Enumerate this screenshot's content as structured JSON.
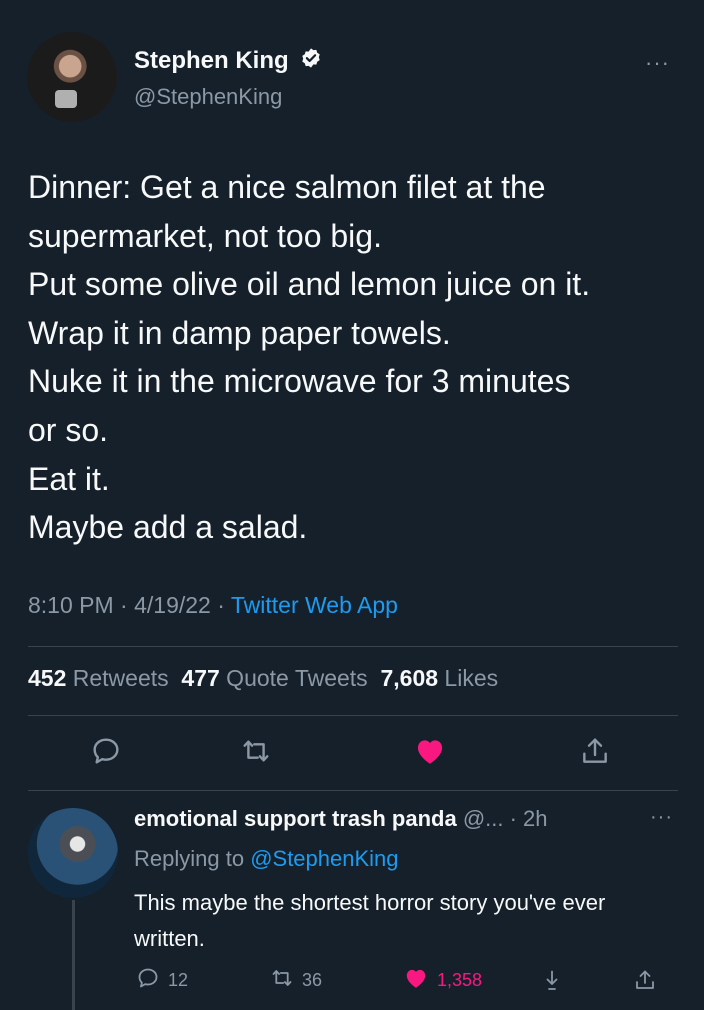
{
  "tweet": {
    "author_name": "Stephen King",
    "author_handle": "@StephenKing",
    "more_glyph": "···",
    "body_lines": [
      "Dinner: Get a nice salmon filet at the",
      "supermarket, not too big.",
      "Put some olive oil and lemon juice on it.",
      "Wrap it in damp paper towels.",
      "Nuke it in the microwave for 3 minutes",
      "or so.",
      "Eat it.",
      "Maybe add a salad."
    ],
    "time": "8:10 PM",
    "separator": " · ",
    "date": "4/19/22",
    "source": "Twitter Web App",
    "stats": {
      "retweets_count": "452",
      "retweets_label": " Retweets",
      "quotes_count": "477",
      "quotes_label": " Quote Tweets",
      "likes_count": "7,608",
      "likes_label": " Likes"
    },
    "liked": true
  },
  "reply": {
    "author_name": "emotional support trash panda",
    "meta": " @... · 2h",
    "more_glyph": "···",
    "replying_prefix": "Replying to ",
    "replying_to": "@StephenKing",
    "text": "This maybe the shortest horror story you've ever written.",
    "actions": {
      "replies": "12",
      "retweets": "36",
      "likes": "1,358"
    },
    "liked": true
  },
  "icons": {
    "reply": "reply-icon",
    "retweet": "retweet-icon",
    "like": "heart-icon",
    "share": "share-icon",
    "bookmark": "bookmark-download-icon",
    "verified": "verified-badge-icon"
  },
  "colors": {
    "background": "#15202b",
    "text": "#f7f9f9",
    "secondary": "#8b98a5",
    "link": "#1d9bf0",
    "like": "#f91880",
    "divider": "#38444d"
  }
}
